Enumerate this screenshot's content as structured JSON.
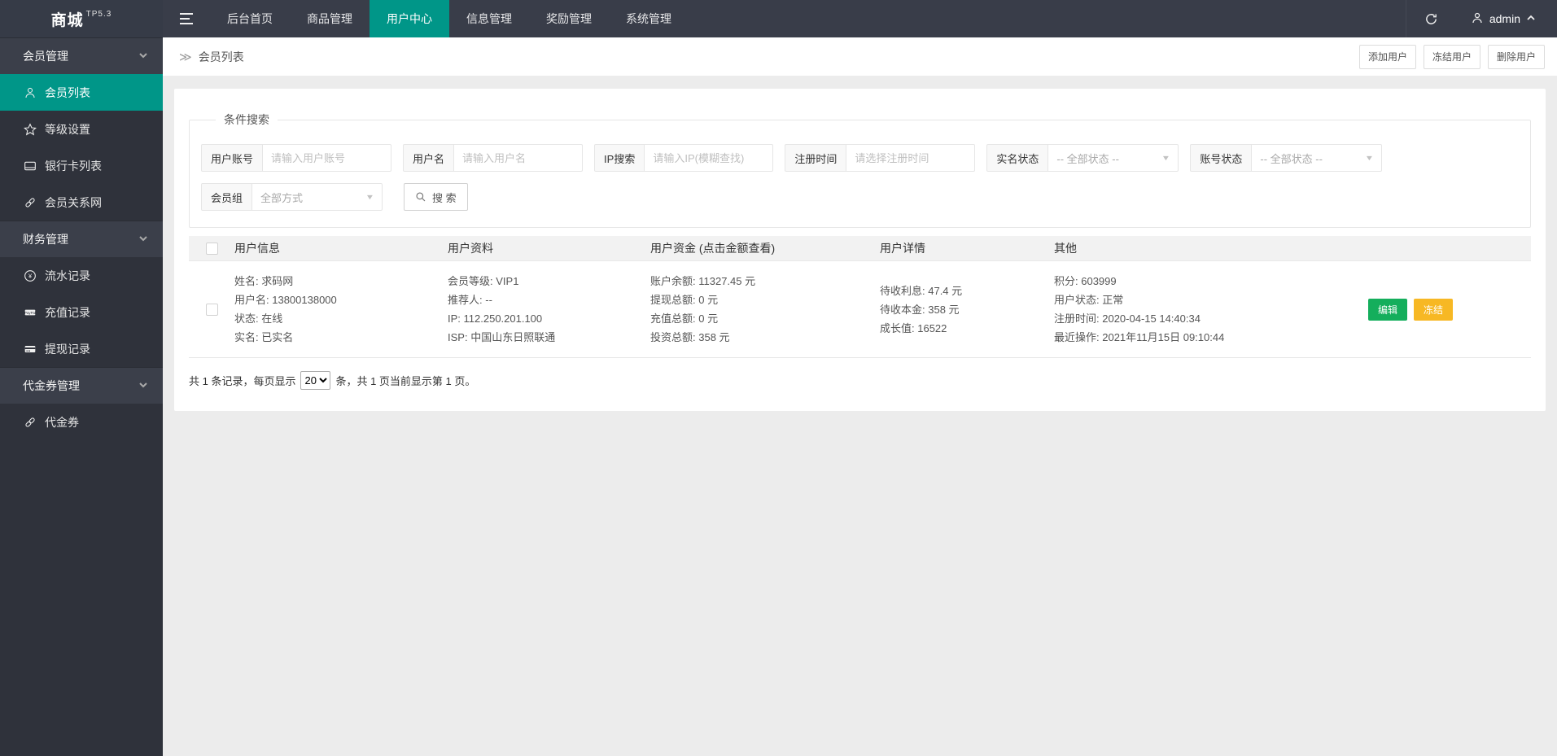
{
  "topbar": {
    "logo": "商城",
    "logo_version": "TP5.3",
    "nav": [
      {
        "label": "后台首页",
        "active": false
      },
      {
        "label": "商品管理",
        "active": false
      },
      {
        "label": "用户中心",
        "active": true
      },
      {
        "label": "信息管理",
        "active": false
      },
      {
        "label": "奖励管理",
        "active": false
      },
      {
        "label": "系统管理",
        "active": false
      }
    ],
    "username": "admin"
  },
  "sidebar": {
    "sections": [
      {
        "title": "会员管理",
        "items": [
          {
            "label": "会员列表",
            "icon": "user-icon",
            "active": true
          },
          {
            "label": "等级设置",
            "icon": "star-icon",
            "active": false
          },
          {
            "label": "银行卡列表",
            "icon": "bank-card-icon",
            "active": false
          },
          {
            "label": "会员关系网",
            "icon": "link-icon",
            "active": false
          }
        ]
      },
      {
        "title": "财务管理",
        "items": [
          {
            "label": "流水记录",
            "icon": "yen-circle-icon",
            "active": false
          },
          {
            "label": "充值记录",
            "icon": "paypal-icon",
            "active": false
          },
          {
            "label": "提现记录",
            "icon": "credit-card-icon",
            "active": false
          }
        ]
      },
      {
        "title": "代金券管理",
        "items": [
          {
            "label": "代金券",
            "icon": "link-icon",
            "active": false
          }
        ]
      }
    ]
  },
  "breadcrumb": {
    "arrow": "≫",
    "title": "会员列表"
  },
  "page_actions": [
    {
      "label": "添加用户"
    },
    {
      "label": "冻结用户"
    },
    {
      "label": "删除用户"
    }
  ],
  "search": {
    "legend": "条件搜索",
    "fields": [
      {
        "label": "用户账号",
        "placeholder": "请输入用户账号",
        "type": "input"
      },
      {
        "label": "用户名",
        "placeholder": "请输入用户名",
        "type": "input"
      },
      {
        "label": "IP搜索",
        "placeholder": "请输入IP(模糊查找)",
        "type": "input"
      },
      {
        "label": "注册时间",
        "placeholder": "请选择注册时间",
        "type": "input"
      },
      {
        "label": "实名状态",
        "value": "-- 全部状态 --",
        "type": "select"
      },
      {
        "label": "账号状态",
        "value": "-- 全部状态 --",
        "type": "select"
      },
      {
        "label": "会员组",
        "value": "全部方式",
        "type": "select"
      }
    ],
    "dropdown_arrow": "▼",
    "search_button": "搜 索"
  },
  "table": {
    "columns": [
      "用户信息",
      "用户资料",
      "用户资金 (点击金额查看)",
      "用户详情",
      "其他"
    ],
    "row": {
      "user_info": [
        {
          "label": "姓名: ",
          "value": "求码网"
        },
        {
          "label": "用户名: ",
          "value": "13800138000"
        },
        {
          "label": "状态: ",
          "value": "在线"
        },
        {
          "label": "实名: ",
          "value": "已实名"
        }
      ],
      "user_profile": [
        {
          "label": "会员等级: ",
          "value": "VIP1"
        },
        {
          "label": "推荐人: ",
          "value": "--"
        },
        {
          "label": "IP: ",
          "value": "112.250.201.100"
        },
        {
          "label": "ISP: ",
          "value": "中国山东日照联通"
        }
      ],
      "user_funds": [
        {
          "label": "账户余额: ",
          "value": "11327.45 元"
        },
        {
          "label": "提现总额: ",
          "value": "0 元"
        },
        {
          "label": "充值总额: ",
          "value": "0 元"
        },
        {
          "label": "投资总额: ",
          "value": "358 元"
        }
      ],
      "user_detail": [
        {
          "label": "待收利息: ",
          "value": "47.4 元"
        },
        {
          "label": "待收本金: ",
          "value": "358 元"
        },
        {
          "label": "成长值: ",
          "value": "16522"
        }
      ],
      "other": [
        {
          "label": "积分: ",
          "value": "603999"
        },
        {
          "label": "用户状态: ",
          "value": "正常"
        },
        {
          "label": "注册时间: ",
          "value": "2020-04-15 14:40:34"
        },
        {
          "label": "最近操作: ",
          "value": "2021年11月15日 09:10:44"
        }
      ],
      "actions": [
        {
          "label": "编辑"
        },
        {
          "label": "冻结"
        }
      ]
    }
  },
  "pagination": {
    "prefix": "共 1 条记录，每页显示",
    "page_size": "20",
    "suffix": "条，共 1 页当前显示第 1 页。"
  },
  "colors": {
    "accent_teal": "#009688",
    "topbar_bg": "#393D49",
    "sidebar_bg": "#2F323B",
    "link_blue": "#1E9FFF",
    "status_green": "#0CBE34",
    "money_red": "#FF3333",
    "money_orange": "#FFB800",
    "edit_button_green": "#14AE5C",
    "freeze_button_yellow": "#F7B824"
  }
}
